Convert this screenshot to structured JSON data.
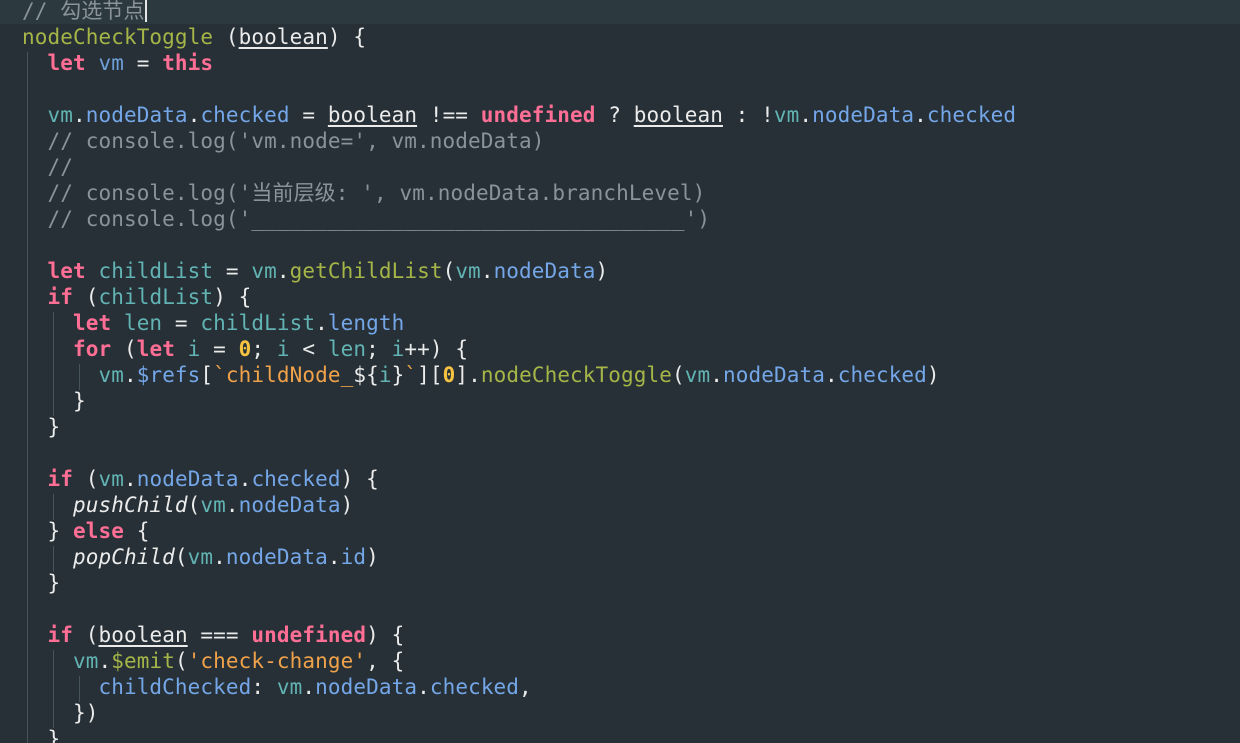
{
  "lines": [
    [
      {
        "t": "// 勾选节点",
        "c": "cm"
      }
    ],
    [
      {
        "t": "nodeCheckToggle",
        "c": "fn"
      },
      {
        "t": " (",
        "c": "pn"
      },
      {
        "t": "boolean",
        "c": "ul"
      },
      {
        "t": ") {",
        "c": "pn"
      }
    ],
    [
      {
        "t": "  let",
        "c": "kw"
      },
      {
        "t": " vm",
        "c": "var"
      },
      {
        "t": " = ",
        "c": "op"
      },
      {
        "t": "this",
        "c": "kw"
      }
    ],
    [],
    [
      {
        "t": "  vm",
        "c": "ivar"
      },
      {
        "t": ".",
        "c": "op"
      },
      {
        "t": "nodeData",
        "c": "prop"
      },
      {
        "t": ".",
        "c": "op"
      },
      {
        "t": "checked",
        "c": "prop"
      },
      {
        "t": " = ",
        "c": "op"
      },
      {
        "t": "boolean",
        "c": "ul"
      },
      {
        "t": " !== ",
        "c": "op"
      },
      {
        "t": "undefined",
        "c": "kw"
      },
      {
        "t": " ? ",
        "c": "op"
      },
      {
        "t": "boolean",
        "c": "ul"
      },
      {
        "t": " : !",
        "c": "op"
      },
      {
        "t": "vm",
        "c": "ivar"
      },
      {
        "t": ".",
        "c": "op"
      },
      {
        "t": "nodeData",
        "c": "prop"
      },
      {
        "t": ".",
        "c": "op"
      },
      {
        "t": "checked",
        "c": "prop"
      }
    ],
    [
      {
        "t": "  // console.log('vm.node=', vm.nodeData)",
        "c": "cm"
      }
    ],
    [
      {
        "t": "  //",
        "c": "cm"
      }
    ],
    [
      {
        "t": "  // console.log('当前层级: ', vm.nodeData.branchLevel)",
        "c": "cm"
      }
    ],
    [
      {
        "t": "  // console.log('__________________________________')",
        "c": "cm"
      }
    ],
    [],
    [
      {
        "t": "  let",
        "c": "kw"
      },
      {
        "t": " childList",
        "c": "ivar"
      },
      {
        "t": " = ",
        "c": "op"
      },
      {
        "t": "vm",
        "c": "ivar"
      },
      {
        "t": ".",
        "c": "op"
      },
      {
        "t": "getChildList",
        "c": "fn"
      },
      {
        "t": "(",
        "c": "pn"
      },
      {
        "t": "vm",
        "c": "ivar"
      },
      {
        "t": ".",
        "c": "op"
      },
      {
        "t": "nodeData",
        "c": "prop"
      },
      {
        "t": ")",
        "c": "pn"
      }
    ],
    [
      {
        "t": "  if",
        "c": "kw"
      },
      {
        "t": " (",
        "c": "pn"
      },
      {
        "t": "childList",
        "c": "ivar"
      },
      {
        "t": ") {",
        "c": "pn"
      }
    ],
    [
      {
        "t": "    let",
        "c": "kw"
      },
      {
        "t": " len",
        "c": "ivar"
      },
      {
        "t": " = ",
        "c": "op"
      },
      {
        "t": "childList",
        "c": "ivar"
      },
      {
        "t": ".",
        "c": "op"
      },
      {
        "t": "length",
        "c": "prop"
      }
    ],
    [
      {
        "t": "    for",
        "c": "kw"
      },
      {
        "t": " (",
        "c": "pn"
      },
      {
        "t": "let",
        "c": "kw"
      },
      {
        "t": " i",
        "c": "ivar"
      },
      {
        "t": " = ",
        "c": "op"
      },
      {
        "t": "0",
        "c": "num"
      },
      {
        "t": "; ",
        "c": "op"
      },
      {
        "t": "i",
        "c": "ivar"
      },
      {
        "t": " < ",
        "c": "op"
      },
      {
        "t": "len",
        "c": "ivar"
      },
      {
        "t": "; ",
        "c": "op"
      },
      {
        "t": "i",
        "c": "ivar"
      },
      {
        "t": "++) {",
        "c": "op"
      }
    ],
    [
      {
        "t": "      vm",
        "c": "ivar"
      },
      {
        "t": ".",
        "c": "op"
      },
      {
        "t": "$refs",
        "c": "prop"
      },
      {
        "t": "[",
        "c": "pn"
      },
      {
        "t": "`childNode_",
        "c": "tpl"
      },
      {
        "t": "${",
        "c": "op"
      },
      {
        "t": "i",
        "c": "ivar"
      },
      {
        "t": "}",
        "c": "op"
      },
      {
        "t": "`",
        "c": "tpl"
      },
      {
        "t": "][",
        "c": "pn"
      },
      {
        "t": "0",
        "c": "num"
      },
      {
        "t": "].",
        "c": "pn"
      },
      {
        "t": "nodeCheckToggle",
        "c": "fn"
      },
      {
        "t": "(",
        "c": "pn"
      },
      {
        "t": "vm",
        "c": "ivar"
      },
      {
        "t": ".",
        "c": "op"
      },
      {
        "t": "nodeData",
        "c": "prop"
      },
      {
        "t": ".",
        "c": "op"
      },
      {
        "t": "checked",
        "c": "prop"
      },
      {
        "t": ")",
        "c": "pn"
      }
    ],
    [
      {
        "t": "    }",
        "c": "pn"
      }
    ],
    [
      {
        "t": "  }",
        "c": "pn"
      }
    ],
    [],
    [
      {
        "t": "  if",
        "c": "kw"
      },
      {
        "t": " (",
        "c": "pn"
      },
      {
        "t": "vm",
        "c": "ivar"
      },
      {
        "t": ".",
        "c": "op"
      },
      {
        "t": "nodeData",
        "c": "prop"
      },
      {
        "t": ".",
        "c": "op"
      },
      {
        "t": "checked",
        "c": "prop"
      },
      {
        "t": ") {",
        "c": "pn"
      }
    ],
    [
      {
        "t": "    pushChild",
        "c": "ital"
      },
      {
        "t": "(",
        "c": "pn"
      },
      {
        "t": "vm",
        "c": "ivar"
      },
      {
        "t": ".",
        "c": "op"
      },
      {
        "t": "nodeData",
        "c": "prop"
      },
      {
        "t": ")",
        "c": "pn"
      }
    ],
    [
      {
        "t": "  } ",
        "c": "pn"
      },
      {
        "t": "else",
        "c": "kw"
      },
      {
        "t": " {",
        "c": "pn"
      }
    ],
    [
      {
        "t": "    popChild",
        "c": "ital"
      },
      {
        "t": "(",
        "c": "pn"
      },
      {
        "t": "vm",
        "c": "ivar"
      },
      {
        "t": ".",
        "c": "op"
      },
      {
        "t": "nodeData",
        "c": "prop"
      },
      {
        "t": ".",
        "c": "op"
      },
      {
        "t": "id",
        "c": "prop"
      },
      {
        "t": ")",
        "c": "pn"
      }
    ],
    [
      {
        "t": "  }",
        "c": "pn"
      }
    ],
    [],
    [
      {
        "t": "  if",
        "c": "kw"
      },
      {
        "t": " (",
        "c": "pn"
      },
      {
        "t": "boolean",
        "c": "ul"
      },
      {
        "t": " === ",
        "c": "op"
      },
      {
        "t": "undefined",
        "c": "kw"
      },
      {
        "t": ") {",
        "c": "pn"
      }
    ],
    [
      {
        "t": "    vm",
        "c": "ivar"
      },
      {
        "t": ".",
        "c": "op"
      },
      {
        "t": "$emit",
        "c": "fn"
      },
      {
        "t": "(",
        "c": "pn"
      },
      {
        "t": "'check-change'",
        "c": "str"
      },
      {
        "t": ", {",
        "c": "pn"
      }
    ],
    [
      {
        "t": "      childChecked",
        "c": "prop"
      },
      {
        "t": ": ",
        "c": "op"
      },
      {
        "t": "vm",
        "c": "ivar"
      },
      {
        "t": ".",
        "c": "op"
      },
      {
        "t": "nodeData",
        "c": "prop"
      },
      {
        "t": ".",
        "c": "op"
      },
      {
        "t": "checked",
        "c": "prop"
      },
      {
        "t": ",",
        "c": "pn"
      }
    ],
    [
      {
        "t": "    })",
        "c": "pn"
      }
    ],
    [
      {
        "t": "  }",
        "c": "pn"
      }
    ]
  ],
  "colors": {
    "background": "#263036",
    "active_line": "#2c3a40",
    "comment": "#8a9399",
    "keyword": "#ff6e95",
    "function": "#a5b547",
    "property": "#74a6e8",
    "variable": "#62b3b3",
    "string": "#f0a24a",
    "number": "#f5c242",
    "plain": "#ebebeb"
  }
}
